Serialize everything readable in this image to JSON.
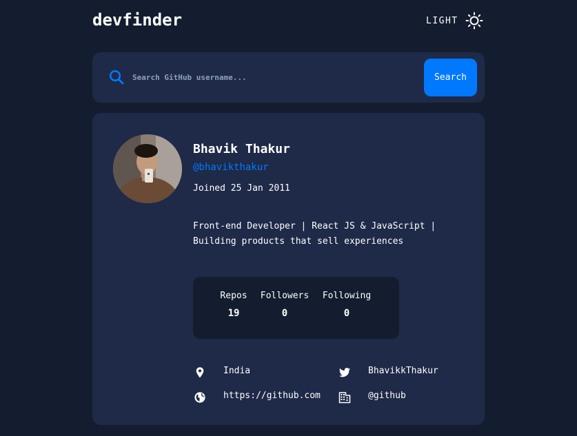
{
  "app": {
    "title": "devfinder",
    "theme_toggle_label": "LIGHT",
    "theme_icon": "sun-icon"
  },
  "search": {
    "placeholder": "Search GitHub username...",
    "value": "",
    "button_label": "Search",
    "icon": "search-icon"
  },
  "profile": {
    "name": "Bhavik Thakur",
    "login": "@bhavikthakur",
    "joined": "Joined 25 Jan 2011",
    "bio_line1": "Front-end Developer | React JS & JavaScript |",
    "bio_line2": "Building products that sell experiences",
    "stats": {
      "repos_label": "Repos",
      "repos_value": "19",
      "followers_label": "Followers",
      "followers_value": "0",
      "following_label": "Following",
      "following_value": "0"
    },
    "links": {
      "location": "India",
      "location_icon": "location-pin-icon",
      "blog": "https://github.com",
      "blog_icon": "globe-icon",
      "twitter": "BhavikkThakur",
      "twitter_icon": "twitter-icon",
      "company": "@github",
      "company_icon": "building-icon"
    }
  },
  "colors": {
    "background": "#141d2f",
    "card": "#1e2a47",
    "accent": "#0079ff",
    "text": "#ffffff",
    "placeholder": "#8ea0bd"
  }
}
